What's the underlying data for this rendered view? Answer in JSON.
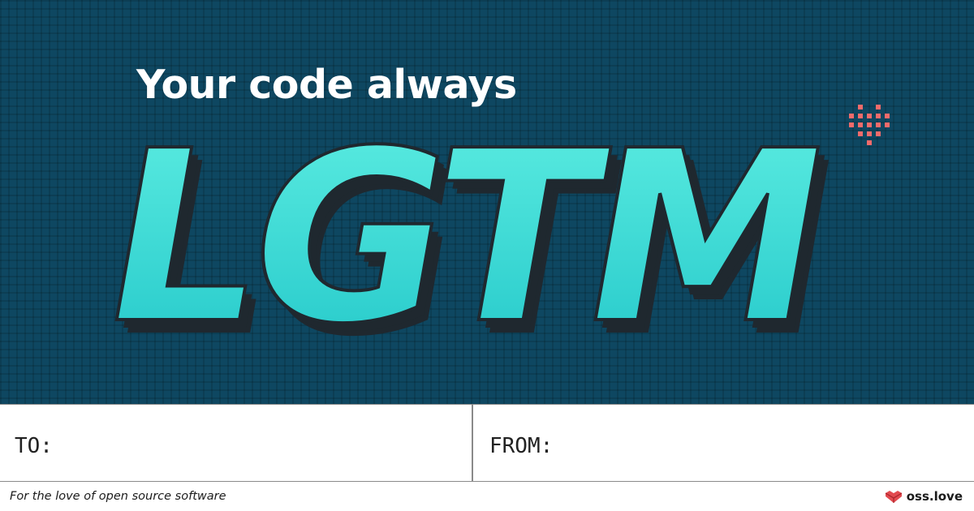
{
  "banner": {
    "headline": "Your code always",
    "big_word": "LGTM",
    "colors": {
      "background": "#0e4761",
      "letter_fill_top": "#5eeee2",
      "letter_fill_bottom": "#22c7c9",
      "letter_shadow": "#1f282f",
      "heart": "#f26b6b"
    },
    "heart_icon": "pixel-heart-icon"
  },
  "card": {
    "to_label": "TO:",
    "from_label": "FROM:"
  },
  "footer": {
    "tagline": "For the love of open source software",
    "brand": "oss.love",
    "brand_icon": "box-heart-logo-icon",
    "brand_color": "#e24a4f"
  }
}
